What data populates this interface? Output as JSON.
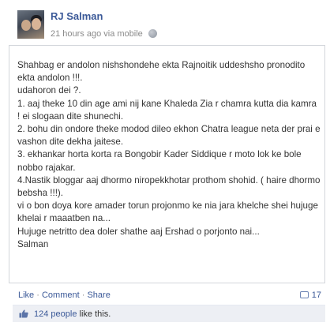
{
  "post": {
    "author": "RJ Salman",
    "timestamp": "21 hours ago",
    "via": "via mobile",
    "privacy_icon": "globe-icon",
    "body": "Shahbag er andolon nishshondehe ekta Rajnoitik uddeshsho pronodito ekta andolon !!!.\nudahoron dei ?.\n1. aaj theke 10 din age ami nij kane Khaleda Zia r chamra kutta dia kamra ! ei slogaan dite shunechi.\n2. bohu din ondore theke modod dileo ekhon Chatra league neta der prai e vashon dite dekha jaitese.\n3. ekhankar horta korta ra Bongobir Kader Siddique r moto lok ke bole nobbo rajakar.\n4.Nastik bloggar aaj dhormo niropekkhotar prothom shohid. ( haire dhormo bebsha !!!).\nvi o bon doya kore amader torun projonmo ke nia jara khelche shei hujuge khelai r maaatben na...\nHujuge netritto dea doler shathe aaj Ershad o porjonto nai...\nSalman"
  },
  "actions": {
    "like": "Like",
    "comment": "Comment",
    "share": "Share",
    "separator": "·",
    "comment_count": "17"
  },
  "likes": {
    "count_text": "124 people",
    "suffix": " like this."
  },
  "colors": {
    "link": "#3b5998",
    "meta": "#8a8a8a",
    "likes_bg": "#edeff4",
    "border": "#d3d6db"
  }
}
